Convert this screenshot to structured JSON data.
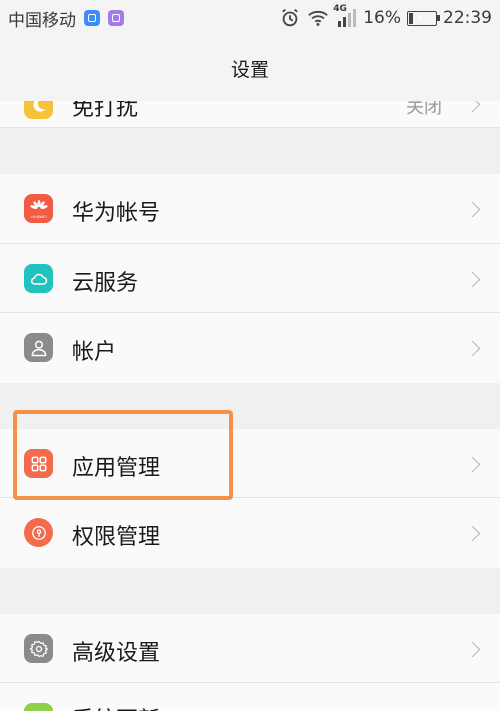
{
  "status_bar": {
    "carrier": "中国移动",
    "signal_type": "4G",
    "battery_percent": "16%",
    "battery_level": 0.16,
    "time": "22:39",
    "icons": [
      "notification-blue-icon",
      "notification-purple-icon",
      "alarm-icon",
      "wifi-icon",
      "cell-signal-icon",
      "battery-icon"
    ]
  },
  "header": {
    "title": "设置"
  },
  "settings": {
    "dnd": {
      "label": "免打扰",
      "value": "关闭",
      "icon": "moon-icon",
      "color": "#f5c23a"
    },
    "huawei_account": {
      "label": "华为帐号",
      "icon": "huawei-icon",
      "color": "#f35a44",
      "icon_text": "HUAWEI"
    },
    "cloud": {
      "label": "云服务",
      "icon": "cloud-icon",
      "color": "#22c3be"
    },
    "account": {
      "label": "帐户",
      "icon": "user-icon",
      "color": "#8b8b8b"
    },
    "app_manage": {
      "label": "应用管理",
      "icon": "apps-grid-icon",
      "color": "#f36a4c"
    },
    "permission": {
      "label": "权限管理",
      "icon": "lock-icon",
      "color": "#f36a4c"
    },
    "advanced": {
      "label": "高级设置",
      "icon": "gear-icon",
      "color": "#8b8b8b"
    },
    "system_update": {
      "label": "系统更新",
      "icon": "update-icon",
      "color": "#8fd14a"
    }
  },
  "highlight": {
    "color": "#f39246",
    "target": "应用管理"
  }
}
